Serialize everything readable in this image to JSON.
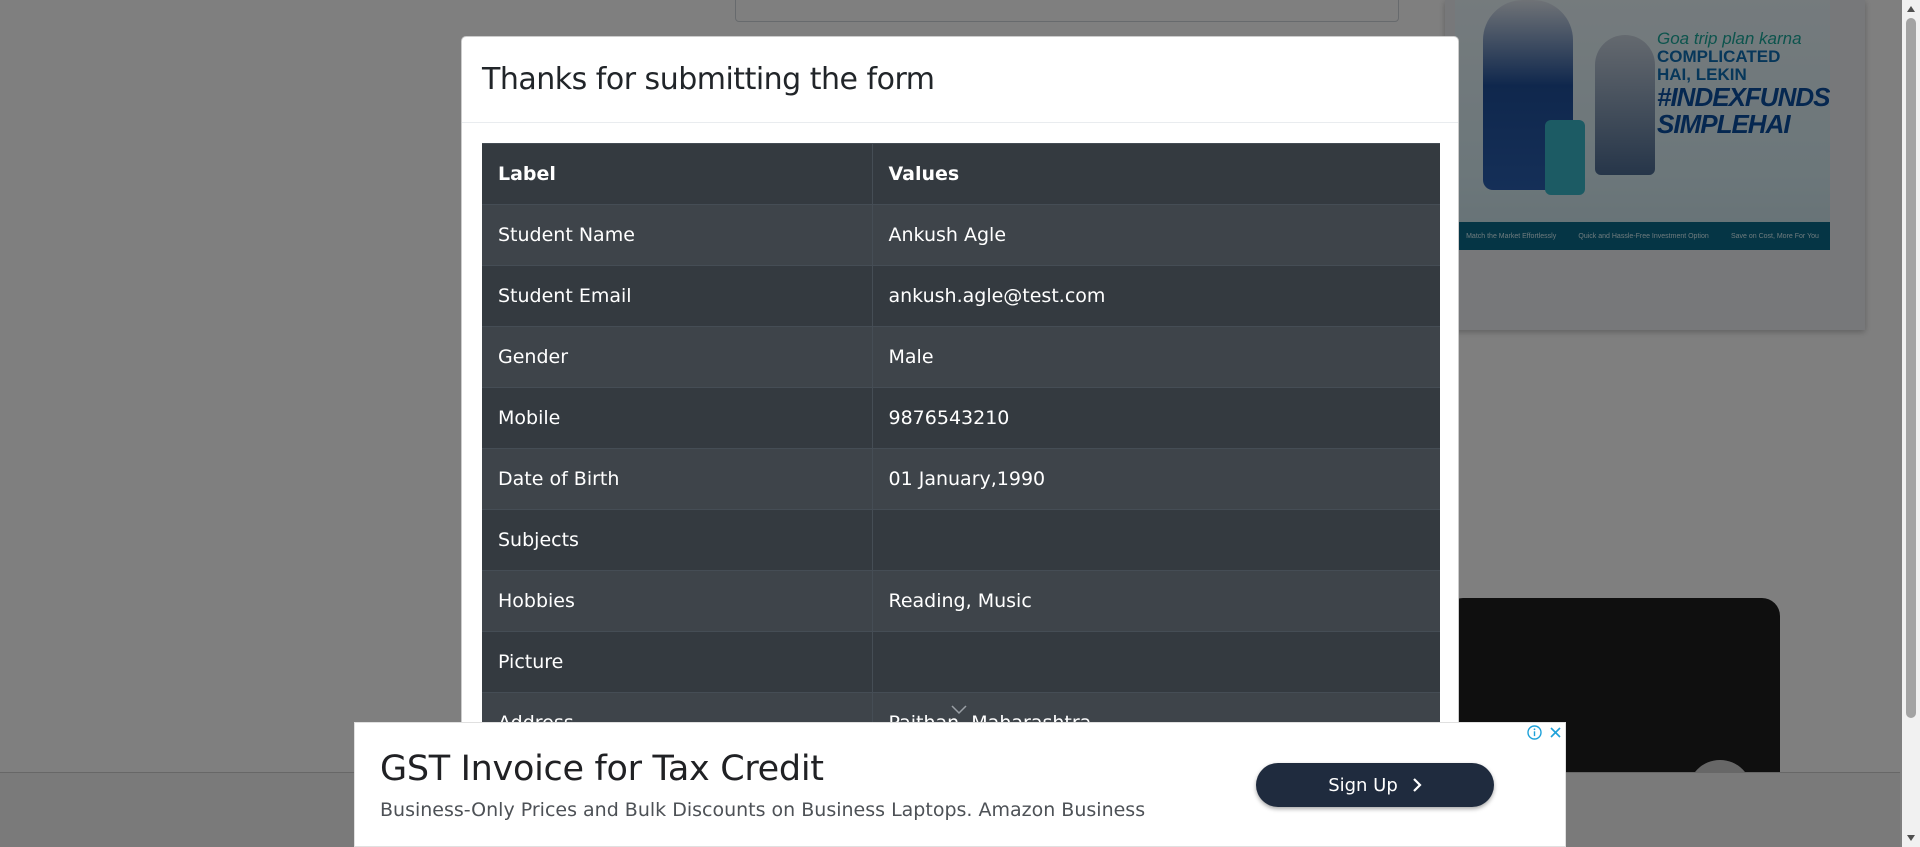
{
  "background": {
    "ad_image": {
      "line1": "Goa trip plan karna",
      "line2a": "COMPLICATED",
      "line2b": "HAI, LEKIN",
      "line3a": "#INDEXFUNDS",
      "line3b": "SIMPLEHAI",
      "strip": [
        "Match the Market Effortlessly",
        "Quick and Hassle-Free Investment Option",
        "Save on Cost, More For You"
      ]
    }
  },
  "modal": {
    "title": "Thanks for submitting the form",
    "table": {
      "headers": [
        "Label",
        "Values"
      ],
      "rows": [
        {
          "label": "Student Name",
          "value": "Ankush Agle"
        },
        {
          "label": "Student Email",
          "value": "ankush.agle@test.com"
        },
        {
          "label": "Gender",
          "value": "Male"
        },
        {
          "label": "Mobile",
          "value": "9876543210"
        },
        {
          "label": "Date of Birth",
          "value": "01 January,1990"
        },
        {
          "label": "Subjects",
          "value": ""
        },
        {
          "label": "Hobbies",
          "value": "Reading, Music"
        },
        {
          "label": "Picture",
          "value": ""
        },
        {
          "label": "Address",
          "value": "Paithan, Maharashtra"
        }
      ]
    }
  },
  "ad_banner": {
    "title": "GST Invoice for Tax Credit",
    "description": "Business-Only Prices and Bulk Discounts on Business Laptops. Amazon Business",
    "cta_label": "Sign Up"
  },
  "colors": {
    "table_dark": "#343a40",
    "table_stripe": "#3e444a",
    "cta_bg": "#1f2b3e",
    "ad_control": "#1ea1d9"
  }
}
